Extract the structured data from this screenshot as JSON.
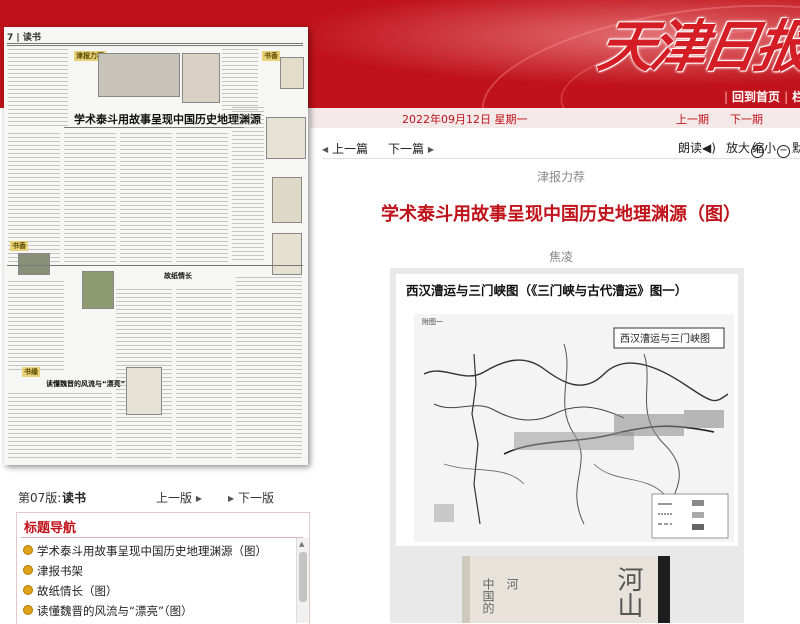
{
  "header": {
    "logo": "天津日报",
    "nav_home": "回到首页",
    "nav_more": "栏"
  },
  "datebar": {
    "date": "2022年09月12日",
    "weekday": "星期一",
    "prev_issue": "上一期",
    "next_issue": "下一期"
  },
  "paper_thumb": {
    "section": "7 | 读书",
    "headline": "学术泰斗用故事呈现中国历史地理渊源",
    "head2": "故纸情长",
    "head3": "读懂魏晋的风流与“漂亮”",
    "tag1": "津报力荐",
    "tag2": "书香",
    "tag3": "书缘"
  },
  "page_nav": {
    "label": "第07版:",
    "name": "读书",
    "prev": "上一版",
    "next": "下一版"
  },
  "title_nav": {
    "heading": "标题导航",
    "items": [
      "学术泰斗用故事呈现中国历史地理渊源（图）",
      "津报书架",
      "故纸情长（图）",
      "读懂魏晋的风流与“漂亮”（图）"
    ]
  },
  "article_toolbar": {
    "prev_article": "上一篇",
    "next_article": "下一篇",
    "read": "朗读",
    "zoom_in": "放大",
    "zoom_out": "缩小",
    "zoom_reset": "默"
  },
  "article": {
    "kicker": "津报力荐",
    "title": "学术泰斗用故事呈现中国历史地理渊源（图）",
    "author": "焦凌",
    "figure_caption": "西汉漕运与三门峡图（《三门峡与古代漕运》图一）",
    "map_title": "西汉漕运与三门峡图",
    "map_label": "附图一"
  },
  "book_cover": {
    "t1": "中国的",
    "t2": "河",
    "t3": "河山"
  },
  "colors": {
    "brand_red": "#c0121a",
    "bullet": "#e0a21a"
  }
}
